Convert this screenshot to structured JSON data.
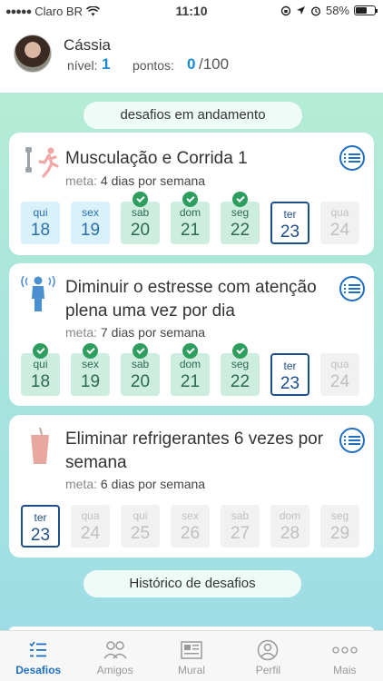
{
  "status_bar": {
    "carrier": "Claro BR",
    "time": "11:10",
    "battery": "58%",
    "battery_level": 0.58
  },
  "user": {
    "name": "Cássia",
    "level_label": "nível:",
    "level": "1",
    "points_label": "pontos:",
    "points": "0",
    "points_max": "/100"
  },
  "section_title": "desafios em andamento",
  "history_button": "Histórico de desafios",
  "challenges": [
    {
      "title": "Musculação e Corrida 1",
      "meta_label": "meta:",
      "meta": "4 dias por semana",
      "icon": "dumbbell-running-icon",
      "days": [
        {
          "name": "qui",
          "num": "18",
          "state": "blue",
          "checked": false
        },
        {
          "name": "sex",
          "num": "19",
          "state": "blue",
          "checked": false
        },
        {
          "name": "sab",
          "num": "20",
          "state": "green",
          "checked": true
        },
        {
          "name": "dom",
          "num": "21",
          "state": "green",
          "checked": true
        },
        {
          "name": "seg",
          "num": "22",
          "state": "green",
          "checked": true
        },
        {
          "name": "ter",
          "num": "23",
          "state": "today",
          "checked": false
        },
        {
          "name": "qua",
          "num": "24",
          "state": "grey",
          "checked": false
        }
      ]
    },
    {
      "title": "Diminuir o estresse com atenção plena uma vez por dia",
      "meta_label": "meta:",
      "meta": "7 dias por semana",
      "icon": "meditation-person-icon",
      "days": [
        {
          "name": "qui",
          "num": "18",
          "state": "green",
          "checked": true
        },
        {
          "name": "sex",
          "num": "19",
          "state": "green",
          "checked": true
        },
        {
          "name": "sab",
          "num": "20",
          "state": "green",
          "checked": true
        },
        {
          "name": "dom",
          "num": "21",
          "state": "green",
          "checked": true
        },
        {
          "name": "seg",
          "num": "22",
          "state": "green",
          "checked": true
        },
        {
          "name": "ter",
          "num": "23",
          "state": "today",
          "checked": false
        },
        {
          "name": "qua",
          "num": "24",
          "state": "grey",
          "checked": false
        }
      ]
    },
    {
      "title": "Eliminar refrigerantes 6 vezes por semana",
      "meta_label": "meta:",
      "meta": "6 dias por semana",
      "icon": "soda-cup-icon",
      "days": [
        {
          "name": "ter",
          "num": "23",
          "state": "today",
          "checked": false
        },
        {
          "name": "qua",
          "num": "24",
          "state": "grey",
          "checked": false
        },
        {
          "name": "qui",
          "num": "25",
          "state": "grey",
          "checked": false
        },
        {
          "name": "sex",
          "num": "26",
          "state": "grey",
          "checked": false
        },
        {
          "name": "sab",
          "num": "27",
          "state": "grey",
          "checked": false
        },
        {
          "name": "dom",
          "num": "28",
          "state": "grey",
          "checked": false
        },
        {
          "name": "seg",
          "num": "29",
          "state": "grey",
          "checked": false
        }
      ]
    }
  ],
  "tabs": [
    {
      "label": "Desafios",
      "icon": "checklist-icon",
      "active": true
    },
    {
      "label": "Amigos",
      "icon": "people-icon",
      "active": false
    },
    {
      "label": "Mural",
      "icon": "newspaper-icon",
      "active": false
    },
    {
      "label": "Perfil",
      "icon": "profile-icon",
      "active": false
    },
    {
      "label": "Mais",
      "icon": "more-dots-icon",
      "active": false
    }
  ],
  "colors": {
    "accent": "#1f6fc2",
    "check": "#2e9e5f",
    "today_border": "#1e4e8c"
  }
}
